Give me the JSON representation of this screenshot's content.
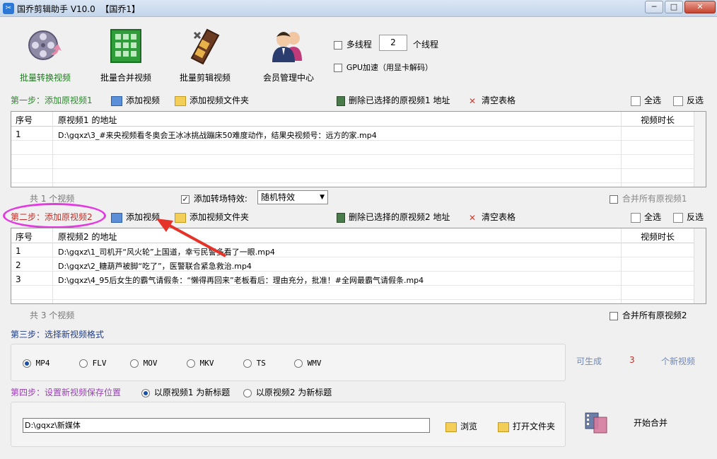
{
  "window": {
    "title": "国乔剪辑助手 V10.0  【国乔1】",
    "min": "─",
    "max": "□",
    "close": "✕"
  },
  "toolbar": [
    {
      "label": "批量转换视频",
      "icon": "film-reel-icon"
    },
    {
      "label": "批量合并视频",
      "icon": "green-building-icon"
    },
    {
      "label": "批量剪辑视频",
      "icon": "film-strip-icon"
    },
    {
      "label": "会员管理中心",
      "icon": "users-icon"
    }
  ],
  "options": {
    "multithread_label": "多线程",
    "thread_count": "2",
    "thread_unit": "个线程",
    "gpu_label": "GPU加速（用显卡解码）"
  },
  "step1": {
    "title": "第一步：添加原视频1",
    "add_video": "添加视频",
    "add_folder": "添加视频文件夹",
    "delete_selected": "删除已选择的原视频1 地址",
    "clear_table": "清空表格",
    "select_all": "全选",
    "invert": "反选",
    "col_index": "序号",
    "col_path": "原视频1 的地址",
    "col_duration": "视频时长",
    "rows": [
      {
        "index": "1",
        "path": "D:\\gqxz\\3_#来央视频看冬奥会王冰冰挑战蹦床50难度动作，结果央视频号：远方的家.mp4",
        "duration": ""
      }
    ],
    "count": "共 1 个视频",
    "merge_all": "合并所有原视频1"
  },
  "transition": {
    "label": "添加转场特效:",
    "value": "随机特效"
  },
  "step2": {
    "title": "第二步：添加原视频2",
    "add_video": "添加视频",
    "add_folder": "添加视频文件夹",
    "delete_selected": "删除已选择的原视频2 地址",
    "clear_table": "清空表格",
    "select_all": "全选",
    "invert": "反选",
    "col_index": "序号",
    "col_path": "原视频2 的地址",
    "col_duration": "视频时长",
    "rows": [
      {
        "index": "1",
        "path": "D:\\gqxz\\1_司机开“风火轮”上国道，幸亏民警多看了一眼.mp4",
        "duration": ""
      },
      {
        "index": "2",
        "path": "D:\\gqxz\\2_糖葫芦被脚“吃了”，医警联合紧急救治.mp4",
        "duration": ""
      },
      {
        "index": "3",
        "path": "D:\\gqxz\\4_95后女生的霸气请假条：“懒得再回来”老板看后：理由充分，批准！#全网最霸气请假条.mp4",
        "duration": ""
      }
    ],
    "count": "共 3 个视频",
    "merge_all": "合并所有原视频2"
  },
  "step3": {
    "title": "第三步：选择新视频格式",
    "formats": [
      "MP4",
      "FLV",
      "MOV",
      "MKV",
      "TS",
      "WMV"
    ],
    "selected": "MP4",
    "can_generate": "可生成",
    "generate_count": "3",
    "generate_unit": "个新视频"
  },
  "step4": {
    "title": "第四步：设置新视频保存位置",
    "opt1": "以原视频1 为新标题",
    "opt2": "以原视频2 为新标题",
    "path": "D:\\gqxz\\新媒体",
    "browse": "浏览",
    "open_folder": "打开文件夹",
    "start": "开始合并"
  },
  "colors": {
    "accent_green": "#2b8a2b",
    "accent_red": "#c0302a",
    "highlight_ellipse": "#e23be0",
    "arrow": "#e5332a"
  }
}
